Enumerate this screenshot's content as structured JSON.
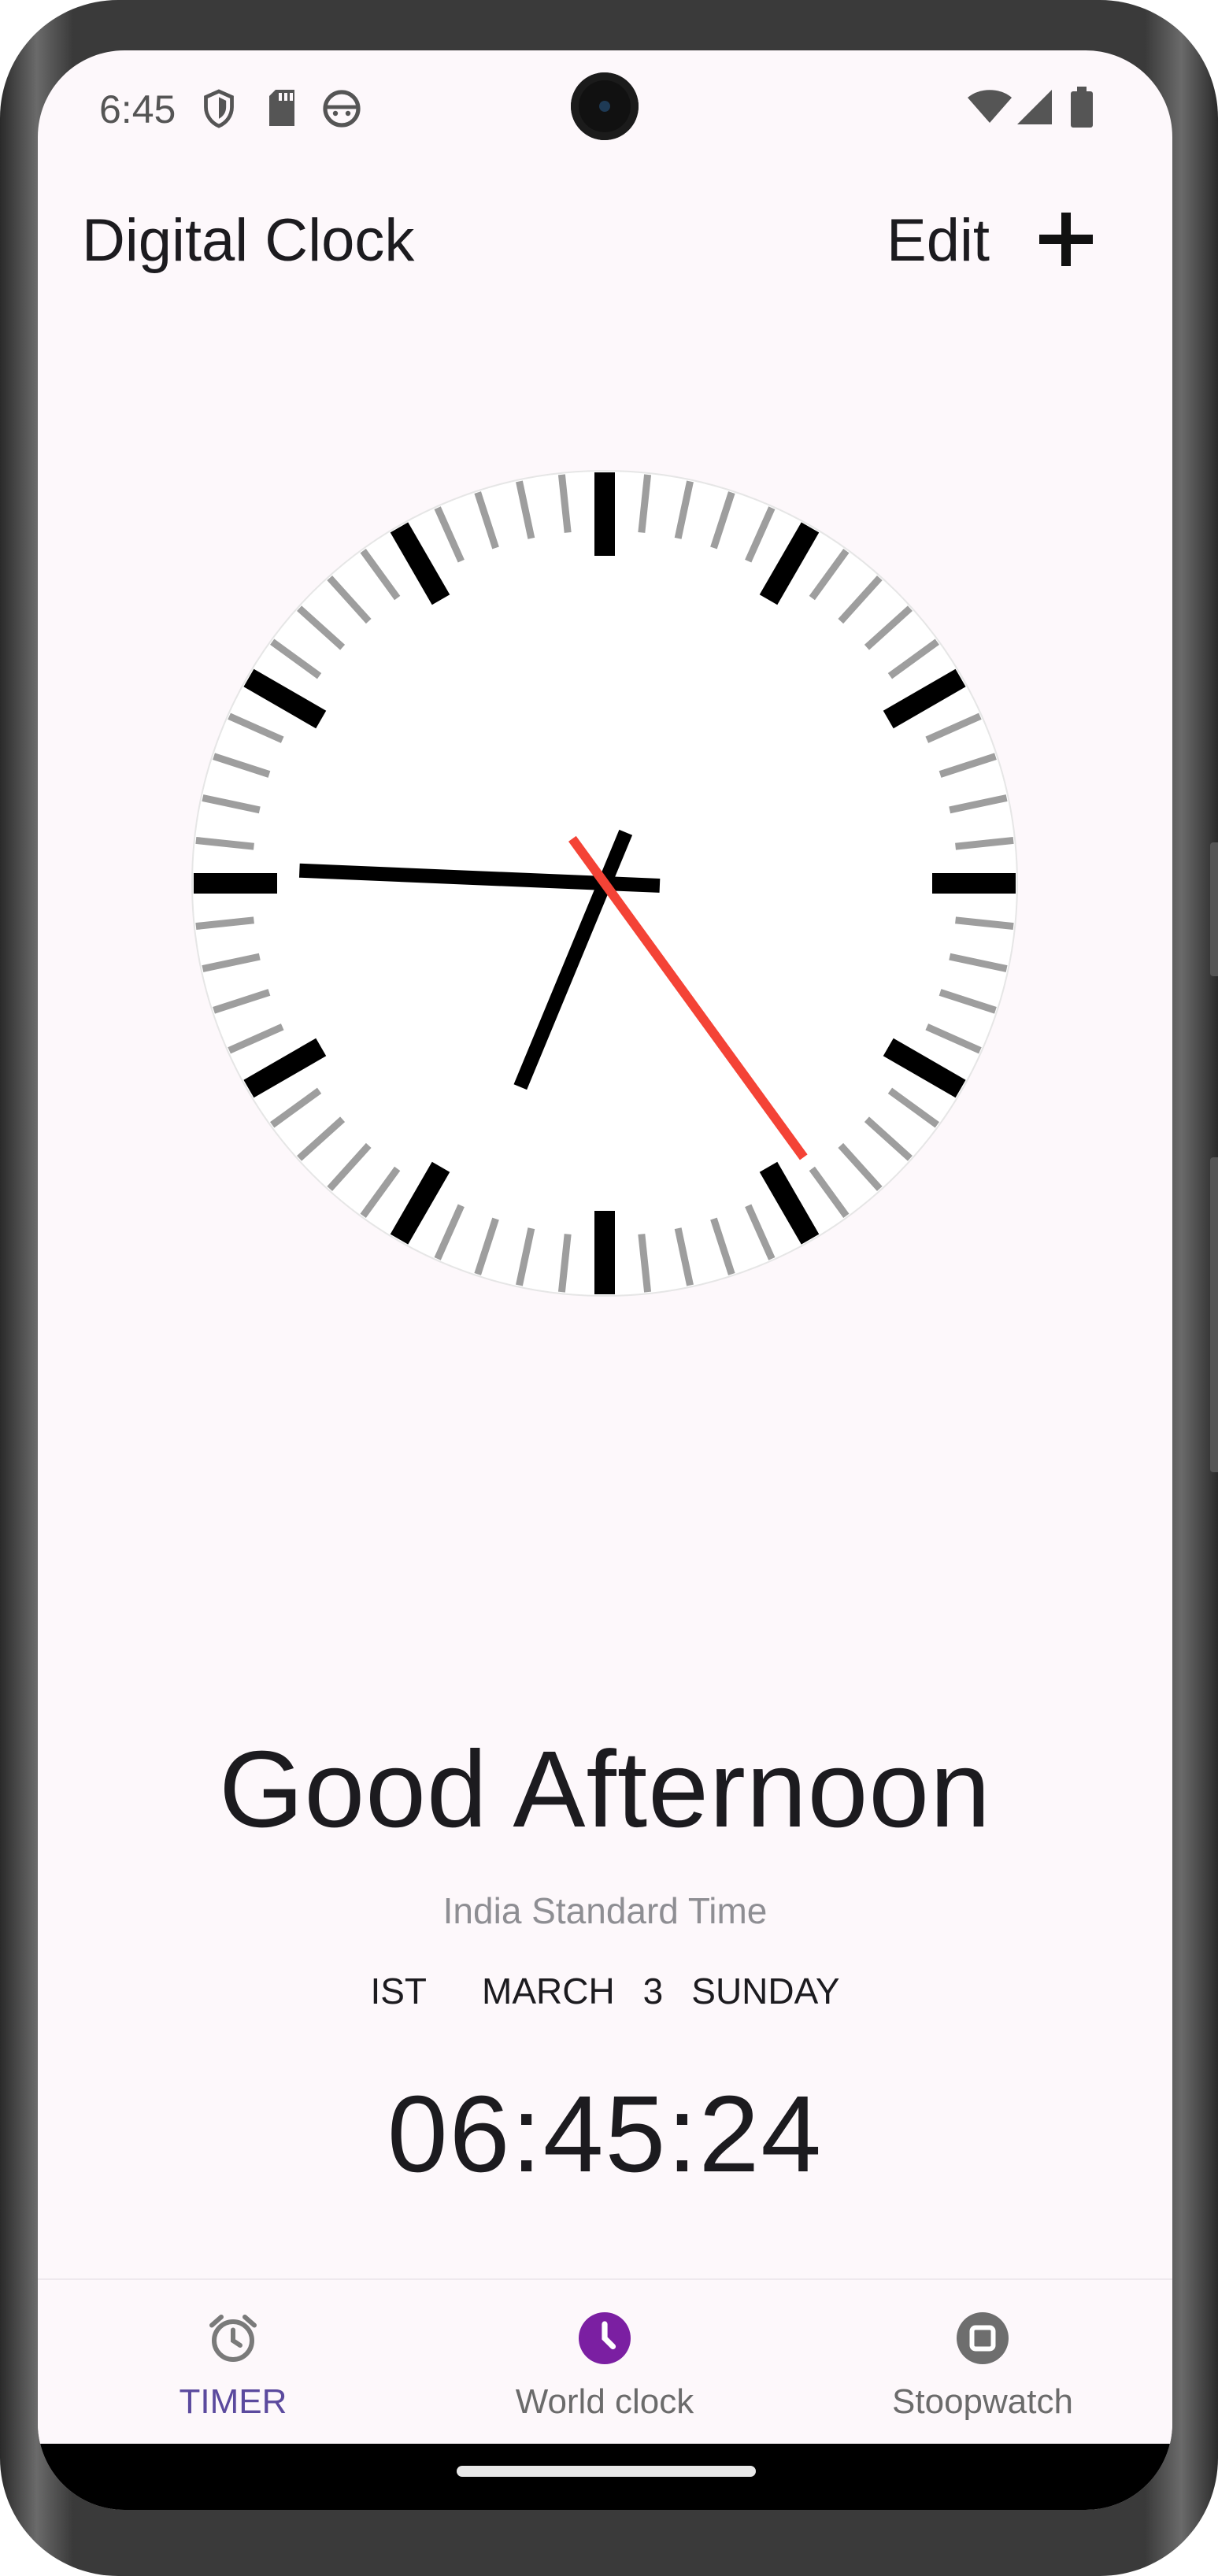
{
  "status_bar": {
    "time": "6:45",
    "left_icons": [
      "shield-icon",
      "sd-card-icon",
      "android-face-icon"
    ],
    "right_icons": [
      "wifi-icon",
      "signal-icon",
      "battery-icon"
    ]
  },
  "app_bar": {
    "title": "Digital Clock",
    "edit_label": "Edit",
    "add_icon": "plus-icon"
  },
  "analog_clock": {
    "hour": 6,
    "minute": 45,
    "second": 24,
    "colors": {
      "face": "#ffffff",
      "hands": "#000000",
      "second_hand": "#f44336",
      "minor_ticks": "#9e9e9e",
      "major_ticks": "#000000"
    }
  },
  "greeting": "Good Afternoon",
  "timezone_name": "India Standard Time",
  "date": {
    "tz_abbr": "IST",
    "month": "MARCH",
    "day": "3",
    "weekday": "SUNDAY"
  },
  "digital_time": "06:45:24",
  "bottom_nav": {
    "items": [
      {
        "label": "TIMER",
        "icon": "alarm-clock-icon",
        "color": "#5b4a9e"
      },
      {
        "label": "World clock",
        "icon": "clock-icon",
        "color": "#6b6b6b",
        "icon_color": "#7b1fa2"
      },
      {
        "label": "Stoopwatch",
        "icon": "stop-icon",
        "color": "#6b6b6b"
      }
    ]
  }
}
